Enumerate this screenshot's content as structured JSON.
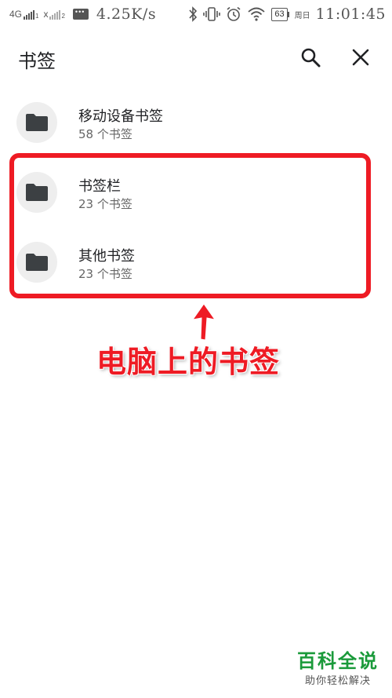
{
  "status_bar": {
    "network1": "4G",
    "network1_sub": "1",
    "network2": "x",
    "network2_sub": "2",
    "speed": "4.25K/s",
    "battery": "63",
    "weekday": "周日",
    "time": "11:01:45",
    "icons": [
      "signal-icon",
      "message-icon",
      "bluetooth-icon",
      "vibrate-icon",
      "alarm-icon",
      "wifi-icon",
      "battery-icon"
    ]
  },
  "app_bar": {
    "title": "书签",
    "search_icon": "search-icon",
    "close_icon": "close-icon"
  },
  "bookmark_folders": [
    {
      "title": "移动设备书签",
      "subtitle": "58 个书签",
      "icon": "folder-icon"
    },
    {
      "title": "书签栏",
      "subtitle": "23 个书签",
      "icon": "folder-icon"
    },
    {
      "title": "其他书签",
      "subtitle": "23 个书签",
      "icon": "folder-icon"
    }
  ],
  "annotation": {
    "text": "电脑上的书签",
    "color": "#ee1b24"
  },
  "watermark": {
    "main": "百科全说",
    "sub": "助你轻松解决",
    "color": "#1a9a3a"
  }
}
